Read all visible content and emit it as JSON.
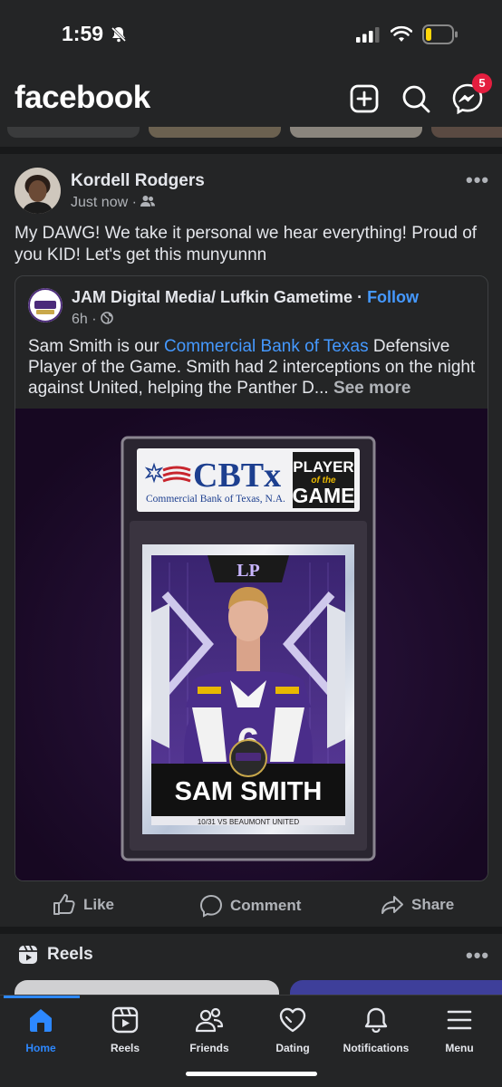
{
  "status": {
    "time": "1:59"
  },
  "header": {
    "logo": "facebook",
    "messenger_badge": "5",
    "icons": [
      "add-icon",
      "search-icon",
      "messenger-icon"
    ]
  },
  "post": {
    "author": "Kordell Rodgers",
    "time": "Just now",
    "audience_icon": "friends-icon",
    "text": "My DAWG! We take it personal we hear everything! Proud of you KID! Let's get this munyunnn",
    "shared": {
      "page_name": "JAM Digital Media/ Lufkin Gametime",
      "separator": " · ",
      "follow": "Follow",
      "time": "6h",
      "text_before": "Sam Smith is our ",
      "link": "Commercial Bank of Texas",
      "text_after": " Defensive Player of the Game. Smith had 2 interceptions on the night against United, helping the Panther D...",
      "see_more": "See more",
      "card": {
        "sponsor_logo": "CBTx",
        "sponsor_name": "Commercial Bank of Texas, N.A.",
        "badge_line1": "PLAYER",
        "badge_line2": "of the",
        "badge_line3": "GAME",
        "team_logo": "LP",
        "player_name": "SAM SMITH",
        "game_line": "10/31 VS BEAUMONT UNITED",
        "jersey_number": "6"
      }
    },
    "actions": {
      "like": "Like",
      "comment": "Comment",
      "share": "Share"
    }
  },
  "reels": {
    "title": "Reels"
  },
  "tabs": [
    {
      "label": "Home",
      "icon": "home-icon",
      "active": true
    },
    {
      "label": "Reels",
      "icon": "reels-icon"
    },
    {
      "label": "Friends",
      "icon": "friends-icon"
    },
    {
      "label": "Dating",
      "icon": "dating-icon"
    },
    {
      "label": "Notifications",
      "icon": "bell-icon"
    },
    {
      "label": "Menu",
      "icon": "menu-icon"
    }
  ],
  "colors": {
    "accent": "#2d88ff",
    "link": "#4599ff",
    "badge": "#e41e3f",
    "background": "#242526"
  }
}
